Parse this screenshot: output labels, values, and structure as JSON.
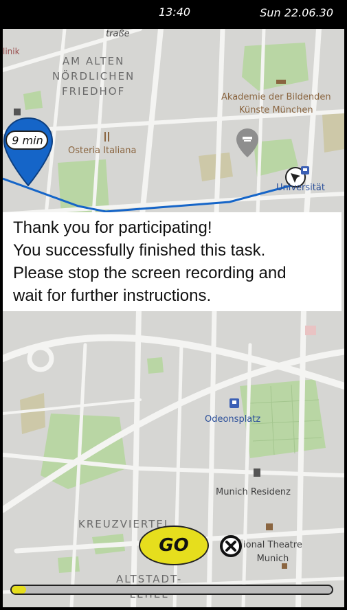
{
  "status_bar": {
    "time": "13:40",
    "date": "Sun 22.06.30"
  },
  "map": {
    "labels": {
      "street_top": "traße",
      "klinik": "linik",
      "district_cemetery": "AM ALTEN\nNÖRDLICHEN\nFRIEDHOF",
      "academy": "Akademie der Bildenden\nKünste München",
      "osteria": "Osteria Italiana",
      "university": "Universität",
      "odeonsplatz": "Odeonsplatz",
      "residenz": "Munich Residenz",
      "kreuzviertel": "KREUZVIERTEL",
      "theatre": "ional Theatre\nMunich",
      "altstadt": "ALTSTADT-\nLEHEL"
    }
  },
  "eta_marker": {
    "text": "9 min",
    "color": "#1565c8"
  },
  "message": {
    "lines": [
      "Thank you for participating!",
      "You successfully finished this task.",
      "Please stop the screen recording and",
      "wait for further instructions."
    ]
  },
  "controls": {
    "go_label": "GO",
    "accent_color": "#e6de1d",
    "progress": 0.045
  }
}
